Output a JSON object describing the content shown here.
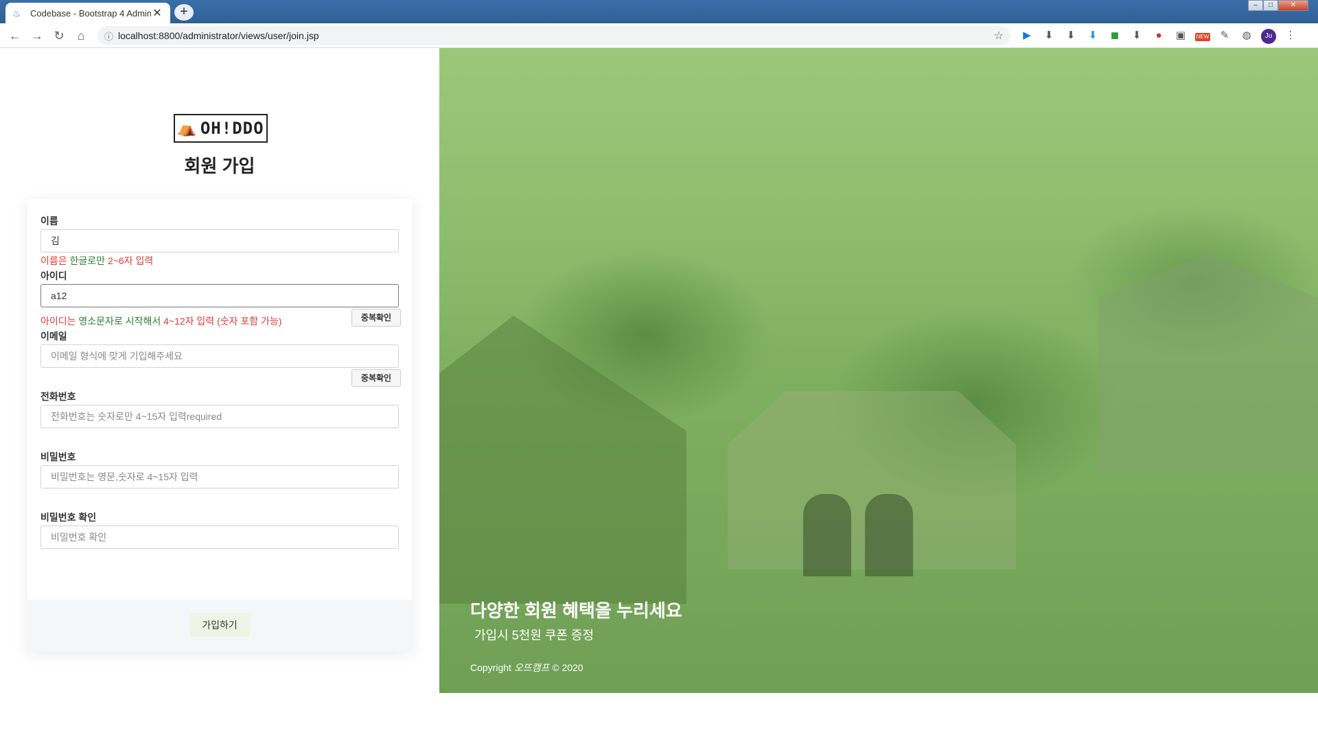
{
  "browser": {
    "tab_title": "Codebase - Bootstrap 4 Admin",
    "new_tab_label": "+",
    "url": "localhost:8800/administrator/views/user/join.jsp",
    "avatar_initials": "Ju",
    "new_badge": "NEW"
  },
  "logo": {
    "text": "OH!DDO"
  },
  "form": {
    "title": "회원 가입",
    "name": {
      "label": "이름",
      "value": "김",
      "hint_red_1": "이름은 ",
      "hint_green": "한글로만",
      "hint_red_2": " 2~6자 입력"
    },
    "id": {
      "label": "아이디",
      "value": "a12",
      "hint_red_1": "아이디는 ",
      "hint_green": "영소문자로 시작해서",
      "hint_red_2": " 4~12자 입력 (숫자 포함 가능)",
      "check_button": "중복확인"
    },
    "email": {
      "label": "이메일",
      "placeholder": "이메일 형식에 맞게 기입해주세요",
      "check_button": "중복확인"
    },
    "phone": {
      "label": "전화번호",
      "placeholder": "전화번호는 숫자로만 4~15자 입력required"
    },
    "password": {
      "label": "비밀번호",
      "placeholder": "비밀번호는 영문,숫자로 4~15자 입력"
    },
    "password_confirm": {
      "label": "비밀번호 확인",
      "placeholder": "비밀번호 확인"
    },
    "submit": "가입하기"
  },
  "promo": {
    "title": "다양한 회원 혜택을 누리세요",
    "subtitle": "가입시 5천원 쿠폰 증정",
    "copyright_prefix": "Copyright ",
    "copyright_brand": "오뜨캠프",
    "copyright_suffix": " © 2020"
  }
}
